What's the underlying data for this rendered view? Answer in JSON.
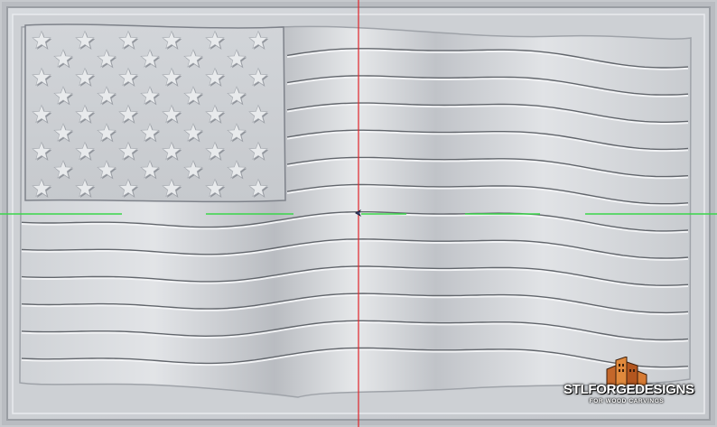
{
  "viewer": {
    "model": "3D carved relief of a waving American flag",
    "stars_rows": 9,
    "stripes": 13,
    "colors": {
      "background": "#c6c9cd",
      "relief_light": "#e4e6e9",
      "relief_shadow": "#8a8e94",
      "groove": "#5e6268",
      "axis_vertical": "#e0242a",
      "axis_horizontal": "#3ad64a",
      "origin_marker": "#1a1f3a"
    },
    "icons": {
      "origin": "crosshair-icon",
      "logo": "building-icon"
    }
  },
  "watermark": {
    "brand": "STLFORGEDESIGNS",
    "tagline": "FOR WOOD CARVINGS"
  }
}
